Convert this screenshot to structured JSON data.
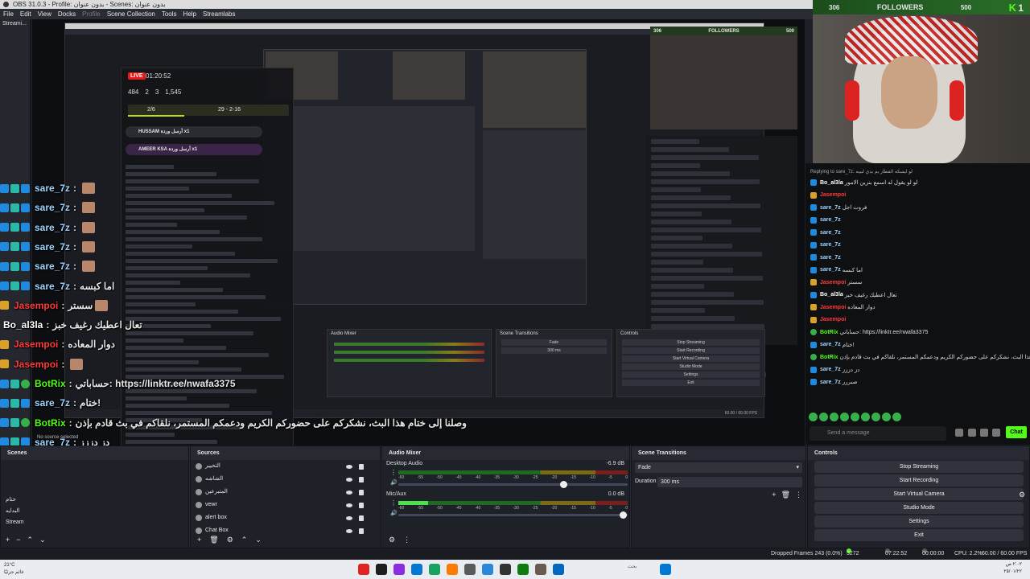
{
  "window": {
    "title": "OBS 31.0.3 - Profile: بدون عنوان - Scenes: بدون عنوان",
    "menu": [
      "File",
      "Edit",
      "View",
      "Docks",
      "Profile",
      "Scene Collection",
      "Tools",
      "Help",
      "Streamlabs"
    ],
    "menu_disabled_index": 4
  },
  "left_dock": {
    "label": "Streami..."
  },
  "popup": {
    "live": "LIVE",
    "timer": "01:20:52",
    "stats": [
      "484",
      "2",
      "3",
      "1,545"
    ],
    "goal": "2/6",
    "goal_right": "29 - 2-16",
    "pinned": [
      {
        "name": "HUSSAM",
        "text": "أرسل وردة",
        "amount": "x1"
      },
      {
        "name": "AMEER KSA",
        "text": "أرسل وردة",
        "amount": "x1"
      }
    ],
    "no_source": "No source selected"
  },
  "overlay_chat": [
    {
      "name": "sare_7z",
      "sep": ":",
      "text": "",
      "badges": [
        "blue",
        "teal",
        "blue"
      ],
      "emote": true,
      "color": "#9fd4ff"
    },
    {
      "name": "sare_7z",
      "sep": ":",
      "text": "",
      "badges": [
        "blue",
        "teal",
        "blue"
      ],
      "emote": true,
      "color": "#9fd4ff"
    },
    {
      "name": "sare_7z",
      "sep": ":",
      "text": "",
      "badges": [
        "blue",
        "teal",
        "blue"
      ],
      "emote": true,
      "color": "#9fd4ff"
    },
    {
      "name": "sare_7z",
      "sep": ":",
      "text": "",
      "badges": [
        "blue",
        "teal",
        "blue"
      ],
      "emote": true,
      "color": "#9fd4ff"
    },
    {
      "name": "sare_7z",
      "sep": ":",
      "text": "",
      "badges": [
        "blue",
        "teal",
        "blue"
      ],
      "emote": true,
      "color": "#9fd4ff"
    },
    {
      "name": "sare_7z",
      "sep": ":",
      "text": "اما كبسه",
      "badges": [
        "blue",
        "teal",
        "blue"
      ],
      "emote": false,
      "color": "#9fd4ff"
    },
    {
      "name": "Jasempoi",
      "sep": ":",
      "text": "سستر",
      "badges": [
        "gold"
      ],
      "emote": true,
      "color": "#ff3b3b"
    },
    {
      "name": "Bo_al3la",
      "sep": ":",
      "text": "تعال اعطيك رغيف خبز",
      "badges": [],
      "emote": false,
      "color": "#ffffff"
    },
    {
      "name": "Jasempoi",
      "sep": ":",
      "text": "دوار المعاده",
      "badges": [
        "gold"
      ],
      "emote": false,
      "color": "#ff3b3b"
    },
    {
      "name": "Jasempoi",
      "sep": ":",
      "text": "",
      "badges": [
        "gold"
      ],
      "emote": true,
      "color": "#ff3b3b"
    },
    {
      "name": "BotRix",
      "sep": ":",
      "text": "حساباتي: https://linktr.ee/nwafa3375",
      "badges": [
        "blue",
        "teal",
        "green"
      ],
      "emote": false,
      "color": "#53fc18"
    },
    {
      "name": "sare_7z",
      "sep": ":",
      "text": "ختام!",
      "badges": [
        "blue",
        "teal",
        "blue"
      ],
      "emote": false,
      "color": "#9fd4ff"
    },
    {
      "name": "BotRix",
      "sep": ":",
      "text": "وصلنا إلى ختام هذا البث، نشكركم على حضوركم الكريم ودعمكم المستمر، نلقاكم في بث قادم بإذن",
      "badges": [
        "blue",
        "teal",
        "green"
      ],
      "emote": false,
      "color": "#53fc18"
    },
    {
      "name": "sare_7z",
      "sep": ":",
      "text": "دز دززز",
      "badges": [
        "blue",
        "teal",
        "blue"
      ],
      "emote": false,
      "color": "#9fd4ff"
    },
    {
      "name": "sare_7z",
      "sep": ":",
      "text": "صبررر",
      "badges": [
        "blue",
        "teal",
        "blue"
      ],
      "emote": false,
      "color": "#9fd4ff"
    }
  ],
  "webcam": {
    "followers_current": "306",
    "followers_label": "FOLLOWERS",
    "followers_goal": "500",
    "kick": "K",
    "count": "1"
  },
  "right_chat": {
    "reply_to": "Replying to sare_7z: لو ليسكه الفطار يم يدي لبيبه",
    "rows": [
      {
        "name": "Bo_al3la",
        "text": "لو لو يقول له اسمع بنزين الامور",
        "color": "#ffffff"
      },
      {
        "name": "Jasempoi",
        "text": "",
        "color": "#ff3b3b"
      },
      {
        "name": "sare_7z",
        "text": "فروت اجل",
        "color": "#9fd4ff"
      },
      {
        "name": "sare_7z",
        "text": "",
        "color": "#9fd4ff"
      },
      {
        "name": "sare_7z",
        "text": "",
        "color": "#9fd4ff"
      },
      {
        "name": "sare_7z",
        "text": "",
        "color": "#9fd4ff"
      },
      {
        "name": "sare_7z",
        "text": "",
        "color": "#9fd4ff"
      },
      {
        "name": "sare_7z",
        "text": "اما كبسه",
        "color": "#9fd4ff"
      },
      {
        "name": "Jasempoi",
        "text": "سستر",
        "color": "#ff3b3b"
      },
      {
        "name": "Bo_al3la",
        "text": "تعال اعطيك رغيف خبز",
        "color": "#ffffff"
      },
      {
        "name": "Jasempoi",
        "text": "دوار المعاده",
        "color": "#ff3b3b"
      },
      {
        "name": "Jasempoi",
        "text": "",
        "color": "#ff3b3b"
      },
      {
        "name": "BotRix",
        "text": "حساباتي: https://linktr.ee/nwafa3375",
        "color": "#53fc18"
      },
      {
        "name": "sare_7z",
        "text": "ختام!",
        "color": "#9fd4ff"
      },
      {
        "name": "BotRix",
        "text": "وصلنا إلى ختام هذا البث، نشكركم على حضوركم الكريم ودعمكم المستمر، نلقاكم في بث قادم بإذن",
        "color": "#53fc18"
      },
      {
        "name": "sare_7z",
        "text": "دز دززز",
        "color": "#9fd4ff"
      },
      {
        "name": "sare_7z",
        "text": "صبررر",
        "color": "#9fd4ff"
      }
    ],
    "input_placeholder": "Send a message",
    "chat_button": "Chat"
  },
  "docks": {
    "scenes_title": "Scenes",
    "scenes": [
      "ختام",
      "البدايه",
      "Stream"
    ],
    "sources_title": "Sources",
    "sources": [
      "التخيير",
      "الشاشه",
      "المتبرعين",
      "vewr",
      "alert box",
      "Chat Box"
    ],
    "mixer_title": "Audio Mixer",
    "mixer": [
      {
        "name": "Desktop Audio",
        "db": "-6.9 dB",
        "level": 0.0,
        "volume": 0.72
      },
      {
        "name": "Mic/Aux",
        "db": "0.0 dB",
        "level": 0.13,
        "volume": 0.98
      }
    ],
    "mixer_scale": [
      "-60",
      "-55",
      "-50",
      "-45",
      "-40",
      "-35",
      "-30",
      "-25",
      "-20",
      "-15",
      "-10",
      "-5",
      "0"
    ],
    "transitions_title": "Scene Transitions",
    "transition": "Fade",
    "duration_label": "Duration",
    "duration": "300 ms",
    "controls_title": "Controls",
    "controls": [
      "Stop Streaming",
      "Start Recording",
      "Start Virtual Camera",
      "Studio Mode",
      "Settings",
      "Exit"
    ]
  },
  "status": {
    "dropped": "Dropped Frames 243 (0.0%)",
    "bitrate": "5272 kbps",
    "stream_time": "07:22:52",
    "rec_time": "00:00:00",
    "cpu": "CPU: 2.2%",
    "fps": "60.00 / 60.00 FPS"
  },
  "taskbar": {
    "weather": "21°C",
    "weather_sub": "غائم جزئيًا",
    "search": "بحث",
    "time": "٢:٠٢ ص",
    "date": "٢٥/٠١/٢٢"
  }
}
